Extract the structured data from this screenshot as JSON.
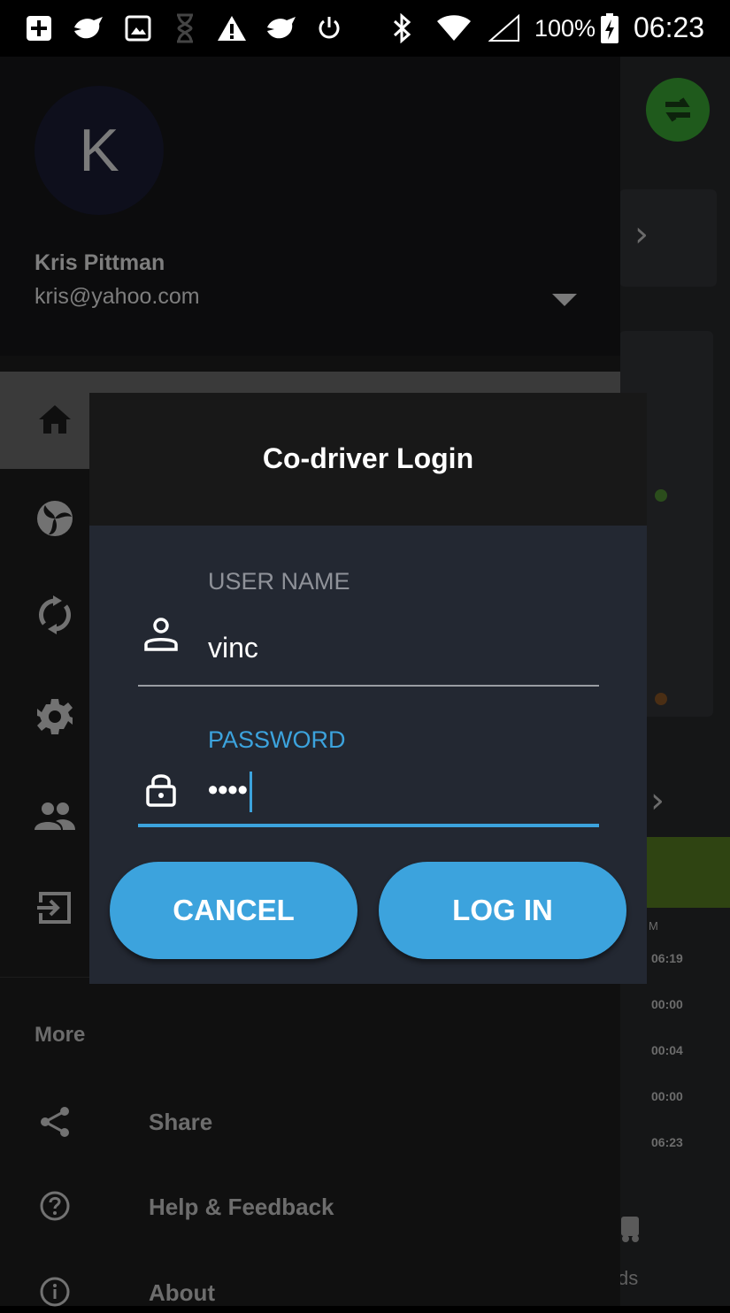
{
  "status_bar": {
    "battery_percent": "100%",
    "time": "06:23",
    "icons": [
      "add-box-icon",
      "bird-icon",
      "image-icon",
      "hourglass-icon",
      "warning-icon",
      "bird-icon",
      "power-icon",
      "bluetooth-icon",
      "wifi-icon",
      "signal-icon",
      "battery-charging-icon"
    ]
  },
  "drawer": {
    "avatar_letter": "K",
    "user_name": "Kris Pittman",
    "user_email": "kris@yahoo.com",
    "items": [
      {
        "icon": "home-icon",
        "active": true
      },
      {
        "icon": "dot-logo-icon",
        "active": false
      },
      {
        "icon": "sync-icon",
        "active": false
      },
      {
        "icon": "settings-icon",
        "active": false
      },
      {
        "icon": "people-icon",
        "active": false
      },
      {
        "icon": "login-icon",
        "active": false
      }
    ],
    "more_section": {
      "label": "More",
      "items": [
        {
          "icon": "share-icon",
          "label": "Share"
        },
        {
          "icon": "help-icon",
          "label": "Help & Feedback"
        },
        {
          "icon": "info-icon",
          "label": "About"
        }
      ]
    }
  },
  "background": {
    "m_label": "M",
    "times": [
      "06:19",
      "00:00",
      "00:04",
      "00:00",
      "06:23"
    ],
    "tab_label": "ds"
  },
  "dialog": {
    "title": "Co-driver Login",
    "username": {
      "label": "USER NAME",
      "value": "vinc"
    },
    "password": {
      "label": "PASSWORD",
      "value": "••••"
    },
    "cancel_label": "CANCEL",
    "login_label": "LOG IN"
  },
  "colors": {
    "accent": "#3ca3dd",
    "dialog_body": "#232832",
    "dialog_header": "#181818"
  }
}
